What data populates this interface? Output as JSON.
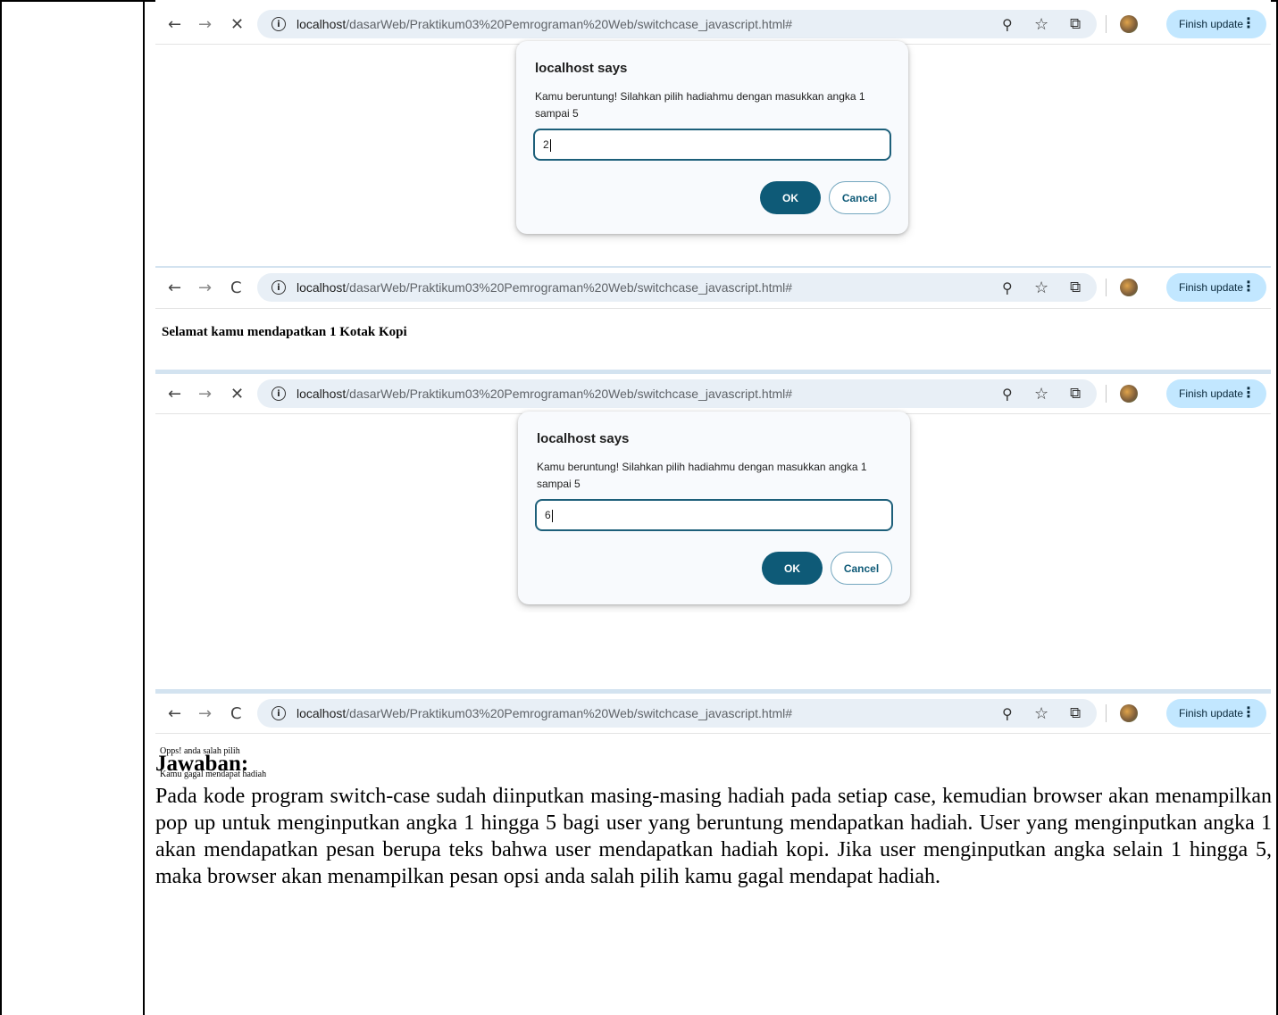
{
  "browser": {
    "url_host": "localhost",
    "url_path": "/dasarWeb/Praktikum03%20Pemrograman%20Web/switchcase_javascript.html#",
    "finish_update_label": "Finish update",
    "nav": {
      "back_icon": "←",
      "forward_icon": "→",
      "stop_icon": "✕",
      "reload_icon": "C",
      "info_icon": "i",
      "zoom_icon": "⚲",
      "star_icon": "☆",
      "extensions_icon": "⧉",
      "kebab_icon": "⋮"
    }
  },
  "dialogs": [
    {
      "title": "localhost says",
      "message": "Kamu beruntung! Silahkan pilih hadiahmu dengan masukkan angka 1 sampai 5",
      "input_value": "2",
      "ok_label": "OK",
      "cancel_label": "Cancel"
    },
    {
      "title": "localhost says",
      "message": "Kamu beruntung! Silahkan pilih hadiahmu dengan masukkan angka 1 sampai 5",
      "input_value": "6",
      "ok_label": "OK",
      "cancel_label": "Cancel"
    }
  ],
  "results": {
    "success_text": "Selamat kamu mendapatkan 1 Kotak Kopi",
    "fail_line1": "Opps! anda salah pilih",
    "fail_line2": "Kamu gagal mendapat hadiah"
  },
  "answer": {
    "title": "Jawaban:",
    "body": "Pada kode program switch-case sudah diinputkan masing-masing hadiah pada setiap case, kemudian browser akan menampilkan pop up untuk menginputkan angka 1 hingga 5 bagi user yang beruntung mendapatkan hadiah. User yang menginputkan angka 1 akan mendapatkan pesan berupa teks bahwa user mendapatkan hadiah kopi. Jika user menginputkan angka selain 1 hingga 5, maka browser akan menampilkan pesan opsi anda salah pilih kamu gagal mendapat hadiah."
  },
  "colors": {
    "ok_button": "#0e5a77",
    "finish_update_bg": "#c2e7ff",
    "omnibox_bg": "#e8eff6",
    "dialog_bg": "#f8fafd"
  }
}
